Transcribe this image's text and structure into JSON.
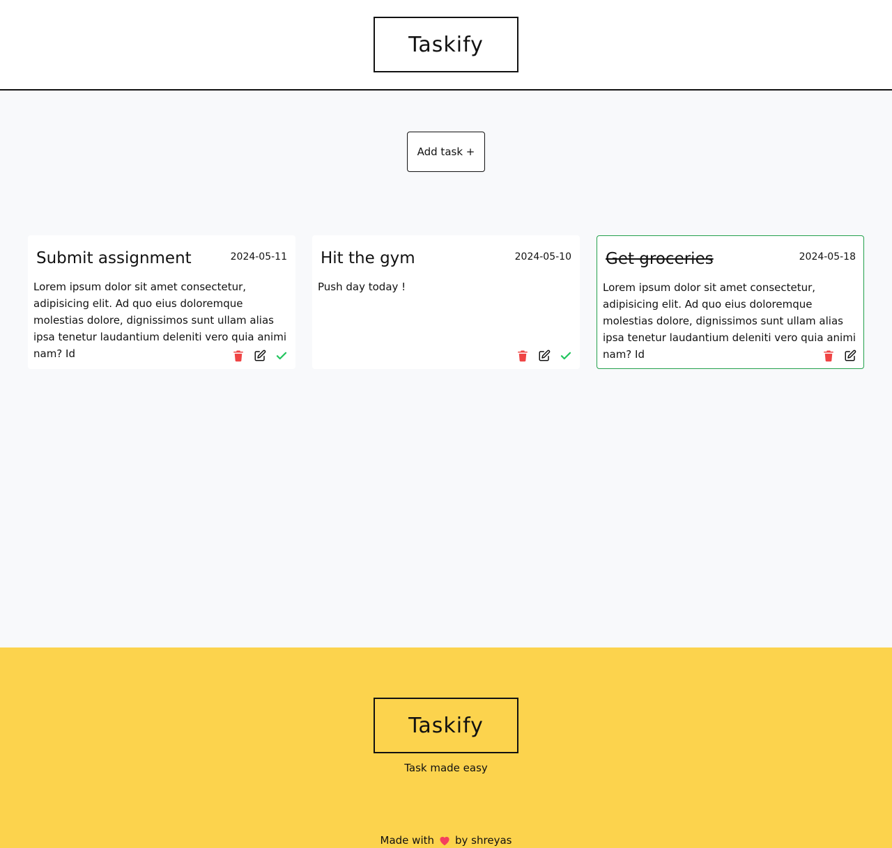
{
  "app": {
    "title": "Taskify"
  },
  "header": {
    "logo": "Taskify"
  },
  "toolbar": {
    "add_task_label": "Add task +"
  },
  "tasks": [
    {
      "title": "Submit assignment",
      "date": "2024-05-11",
      "description": "Lorem ipsum dolor sit amet consectetur, adipisicing elit. Ad quo eius doloremque molestias dolore, dignissimos sunt ullam alias ipsa tenetur laudantium deleniti vero quia animi nam? Id",
      "completed": false
    },
    {
      "title": "Hit the gym",
      "date": "2024-05-10",
      "description": "Push day today !",
      "completed": false
    },
    {
      "title": "Get groceries",
      "date": "2024-05-18",
      "description": "Lorem ipsum dolor sit amet consectetur, adipisicing elit. Ad quo eius doloremque molestias dolore, dignissimos sunt ullam alias ipsa tenetur laudantium deleniti vero quia animi nam? Id",
      "completed": true
    }
  ],
  "icons": {
    "delete": "trash-icon",
    "edit": "edit-icon",
    "complete": "check-icon",
    "love": "heart-icon"
  },
  "colors": {
    "delete": "#ef4444",
    "complete": "#22c55e",
    "footer_bg": "#fcd34d",
    "done_border": "#22a04b"
  },
  "footer": {
    "logo": "Taskify",
    "tagline": "Task made easy",
    "credit_prefix": "Made with",
    "credit_suffix": "by shreyas"
  }
}
